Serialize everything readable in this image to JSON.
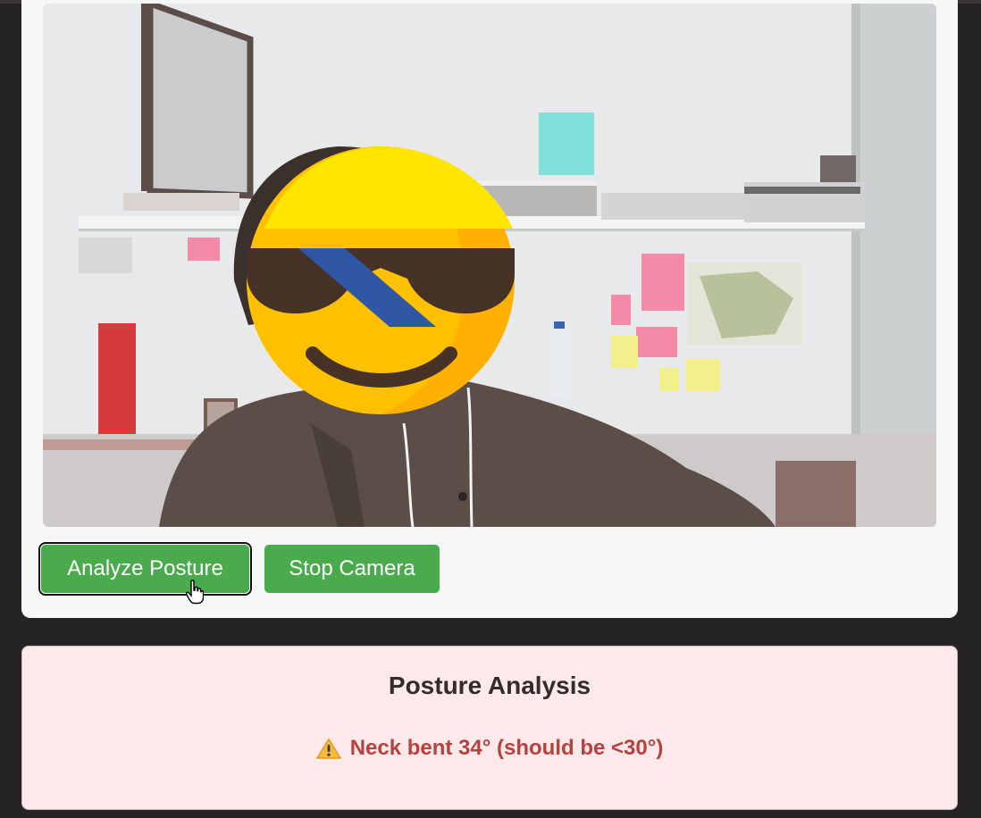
{
  "camera": {
    "feed_label": "webcam-feed",
    "overlay": "sunglasses-emoji-face-cover"
  },
  "controls": {
    "analyze_label": "Analyze Posture",
    "stop_label": "Stop Camera",
    "button_color": "#4aab4d"
  },
  "analysis": {
    "title": "Posture Analysis",
    "warning_icon": "warning-icon",
    "result": "Neck bent 34° (should be <30°)",
    "panel_color": "#fde9ea",
    "result_color": "#b6413f"
  }
}
